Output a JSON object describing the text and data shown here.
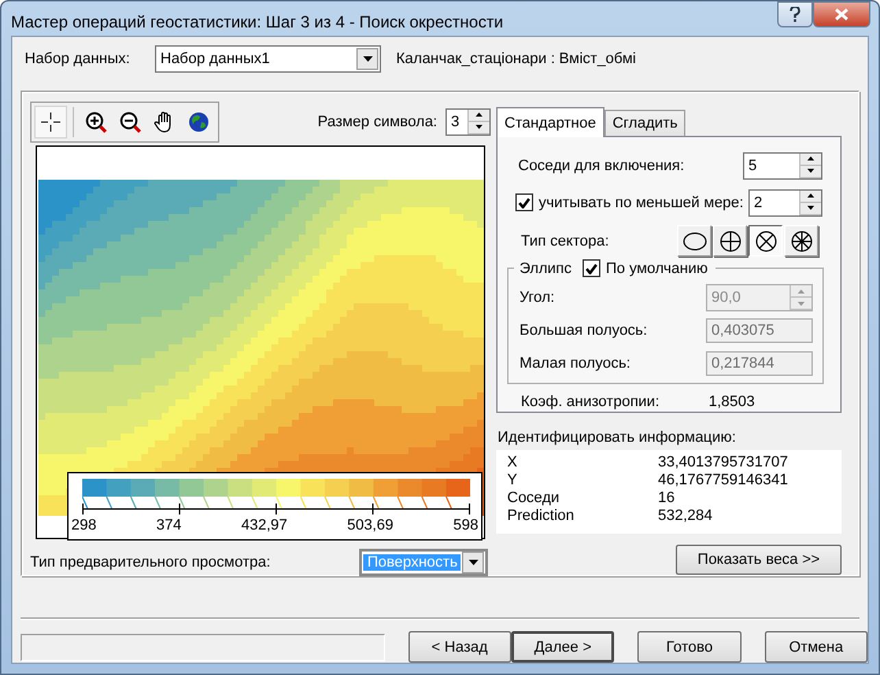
{
  "window": {
    "title": "Мастер операций геостатистики: Шаг 3 из 4 - Поиск окрестности"
  },
  "dataset": {
    "label": "Набор данных:",
    "value": "Набор данных1",
    "source": "Каланчак_стаціонари : Вміст_обмі"
  },
  "toolbar": [
    {
      "kind": "crosshair",
      "selected": true
    },
    {
      "kind": "zoom-in",
      "selected": false
    },
    {
      "kind": "zoom-out",
      "selected": false
    },
    {
      "kind": "hand",
      "selected": false
    },
    {
      "kind": "globe",
      "selected": false
    }
  ],
  "symbol_size": {
    "label": "Размер символа:",
    "value": "3"
  },
  "legend": {
    "ticks": [
      "298",
      "374",
      "432,97",
      "503,69",
      "598"
    ]
  },
  "preview": {
    "label": "Тип предварительного просмотра:",
    "value": "Поверхность"
  },
  "tabs": [
    {
      "label": "Стандартное",
      "selected": true
    },
    {
      "label": "Сгладить",
      "selected": false
    }
  ],
  "neighbors": {
    "label": "Соседи для включения:",
    "value": "5"
  },
  "at_least": {
    "label": "учитывать по меньшей мере:",
    "checked": true,
    "value": "2"
  },
  "sector_type": {
    "label": "Тип сектора:",
    "options": [
      {
        "kind": "one",
        "selected": false
      },
      {
        "kind": "four",
        "selected": false
      },
      {
        "kind": "four-rotated",
        "selected": true
      },
      {
        "kind": "eight",
        "selected": false
      }
    ]
  },
  "ellipse": {
    "title": "Эллипс",
    "default": {
      "label": "По умолчанию",
      "checked": true
    },
    "fields": [
      {
        "kind": "spin",
        "label": "Угол:",
        "value": "90,0",
        "disabled": true
      },
      {
        "kind": "text",
        "label": "Большая полуось:",
        "value": "0,403075",
        "disabled": true
      },
      {
        "kind": "text",
        "label": "Малая полуось:",
        "value": "0,217844",
        "disabled": true
      }
    ]
  },
  "anisotropy": {
    "label": "Коэф. анизотропии:",
    "value": "1,8503"
  },
  "identify": {
    "label": "Идентифицировать информацию:",
    "rows": [
      {
        "name": "X",
        "value": "33,4013795731707"
      },
      {
        "name": "Y",
        "value": "46,1767759146341"
      },
      {
        "name": "Соседи",
        "value": "16"
      },
      {
        "name": "Prediction",
        "value": "532,284"
      }
    ]
  },
  "show_weights": "Показать веса >>",
  "buttons": [
    {
      "label": "< Назад",
      "default": false
    },
    {
      "label": "Далее >",
      "default": true
    },
    {
      "label": "Готово",
      "default": false
    },
    {
      "label": "Отмена",
      "default": false
    }
  ]
}
